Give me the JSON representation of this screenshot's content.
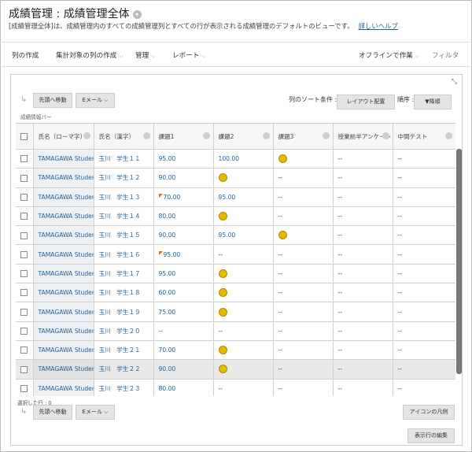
{
  "header": {
    "title": "成績管理 : 成績管理全体",
    "description": "[成績管理全体]は、成績管理内のすべての成績管理列とすべての行が表示される成績管理のデフォルトのビューです。",
    "help_link": "詳しいヘルプ"
  },
  "menu": {
    "create_column": "列の作成",
    "create_calc": "集計対象の列の作成",
    "manage": "管理",
    "reports": "レポート",
    "offline": "オフラインで作業",
    "filter": "フィルタ"
  },
  "toolbar": {
    "move_top": "先頭へ移動",
    "email": "Eメール",
    "sort_label": "列のソート条件 :",
    "sort_value": "レイアウト配置",
    "order_label": "順序 :",
    "order_value": "▼降順",
    "info_bar": "成績情報バー"
  },
  "columns": [
    "氏名（ローマ字）",
    "氏名（漢字）",
    "課題1",
    "課題2",
    "課題3",
    "授業前半アンケート",
    "中間テスト"
  ],
  "rows": [
    {
      "roman": "TAMAGAWA Studen",
      "kanji": "玉川　学生１１",
      "k1": "95.00",
      "k2": "100.00",
      "k3": "smile",
      "q": "--",
      "m": "--"
    },
    {
      "roman": "TAMAGAWA Studen",
      "kanji": "玉川　学生１２",
      "k1": "90.00",
      "k2": "smile",
      "k3": "--",
      "q": "--",
      "m": "--"
    },
    {
      "roman": "TAMAGAWA Studen",
      "kanji": "玉川　学生１３",
      "k1": "70.00",
      "k1_flag": true,
      "k2": "95.00",
      "k3": "--",
      "q": "--",
      "m": "--"
    },
    {
      "roman": "TAMAGAWA Studen",
      "kanji": "玉川　学生１４",
      "k1": "80.00",
      "k2": "smile",
      "k3": "--",
      "q": "--",
      "m": "--"
    },
    {
      "roman": "TAMAGAWA Studen",
      "kanji": "玉川　学生１５",
      "k1": "90.00",
      "k2": "95.00",
      "k3": "smile",
      "q": "--",
      "m": "--"
    },
    {
      "roman": "TAMAGAWA Studen",
      "kanji": "玉川　学生１６",
      "k1": "95.00",
      "k1_flag": true,
      "k2": "--",
      "k3": "--",
      "q": "--",
      "m": "--"
    },
    {
      "roman": "TAMAGAWA Studen",
      "kanji": "玉川　学生１７",
      "k1": "95.00",
      "k2": "smile",
      "k3": "--",
      "q": "--",
      "m": "--"
    },
    {
      "roman": "TAMAGAWA Studen",
      "kanji": "玉川　学生１８",
      "k1": "60.00",
      "k2": "smile",
      "k3": "--",
      "q": "--",
      "m": "--"
    },
    {
      "roman": "TAMAGAWA Studen",
      "kanji": "玉川　学生１９",
      "k1": "75.00",
      "k2": "smile",
      "k3": "--",
      "q": "--",
      "m": "--"
    },
    {
      "roman": "TAMAGAWA Studen",
      "kanji": "玉川　学生２０",
      "k1": "--",
      "k2": "--",
      "k3": "--",
      "q": "--",
      "m": "--"
    },
    {
      "roman": "TAMAGAWA Studen",
      "kanji": "玉川　学生２１",
      "k1": "70.00",
      "k2": "smile",
      "k3": "--",
      "q": "--",
      "m": "--"
    },
    {
      "roman": "TAMAGAWA Studen",
      "kanji": "玉川　学生２２",
      "k1": "90.00",
      "k2": "smile",
      "k3": "--",
      "q": "--",
      "m": "--",
      "selected": true
    },
    {
      "roman": "TAMAGAWA Studen",
      "kanji": "玉川　学生２３",
      "k1": "80.00",
      "k2": "--",
      "k3": "--",
      "q": "--",
      "m": "--"
    }
  ],
  "footer": {
    "selected_rows": "選択した行 : 0",
    "icon_legend": "アイコンの凡例",
    "edit_rows": "表示行の編集"
  },
  "colors": {
    "link": "#1f5f99",
    "smile": "#e6b800",
    "flag": "#e07000"
  }
}
